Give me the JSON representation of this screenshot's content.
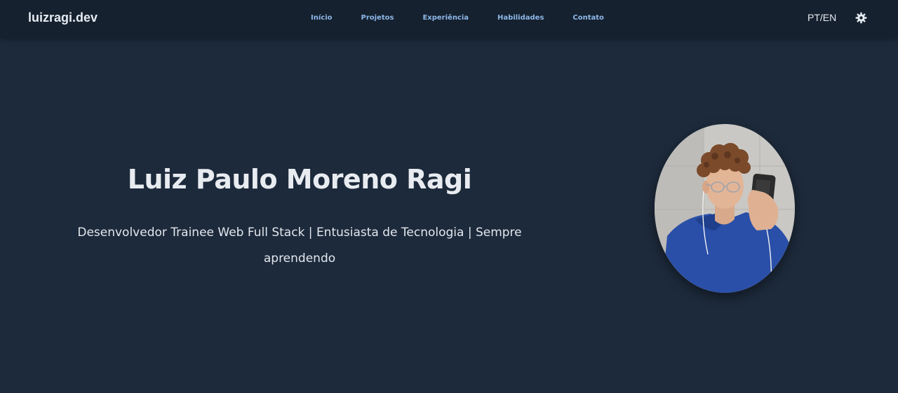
{
  "brand": {
    "label": "luizragi.dev"
  },
  "nav": {
    "items": [
      {
        "label": "Início"
      },
      {
        "label": "Projetos"
      },
      {
        "label": "Experiência"
      },
      {
        "label": "Habilidades"
      },
      {
        "label": "Contato"
      }
    ]
  },
  "header_actions": {
    "language_toggle": "PT/EN",
    "theme_icon": "sun-gear-icon"
  },
  "hero": {
    "name": "Luiz Paulo Moreno Ragi",
    "subtitle": "Desenvolvedor Trainee Web Full Stack | Entusiasta de Tecnologia | Sempre aprendendo",
    "avatar": "profile-photo"
  },
  "colors": {
    "page_background": "#1d2a3b",
    "navbar_background": "#16212f",
    "nav_link": "#8eb8e8",
    "text_primary": "#e8ecf1"
  }
}
